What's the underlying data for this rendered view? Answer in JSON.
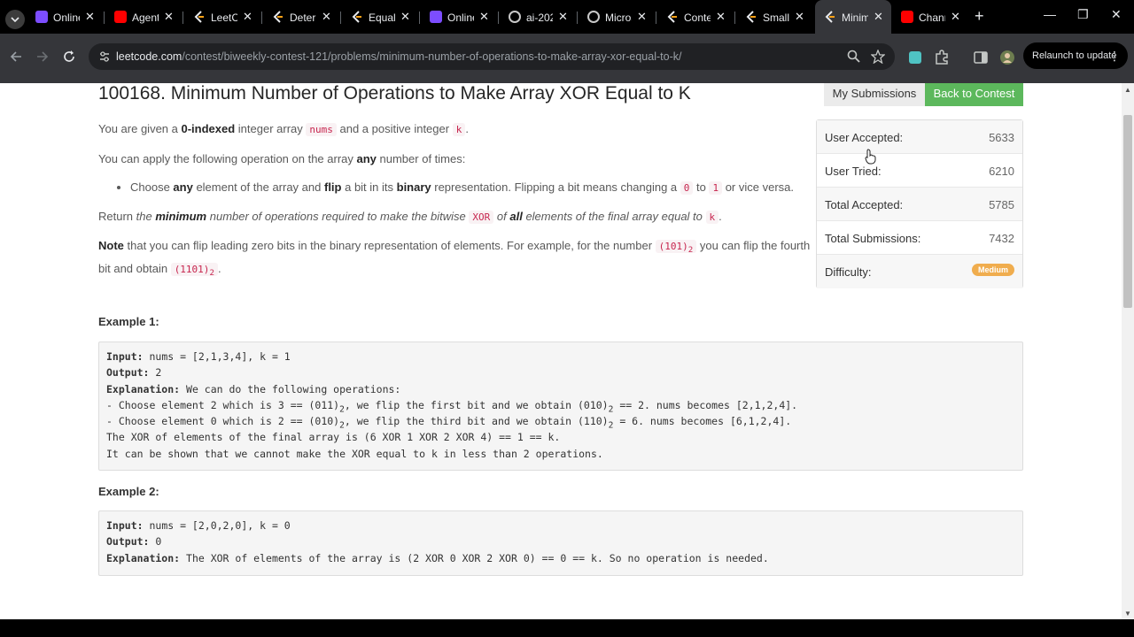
{
  "tabs": [
    {
      "title": "Online",
      "icon": "lightning-icon",
      "color": "#7c4dff"
    },
    {
      "title": "Agents",
      "icon": "youtube-icon",
      "color": "#ff0000"
    },
    {
      "title": "LeetCo",
      "icon": "leetcode-icon",
      "color": "#ffa116"
    },
    {
      "title": "Determ",
      "icon": "leetcode-icon",
      "color": "#ffa116"
    },
    {
      "title": "Equal I",
      "icon": "leetcode-icon",
      "color": "#ffa116"
    },
    {
      "title": "Online",
      "icon": "lightning-icon",
      "color": "#7c4dff"
    },
    {
      "title": "ai-202",
      "icon": "globe-icon",
      "color": "#c8c8c8"
    },
    {
      "title": "Micros",
      "icon": "globe-icon",
      "color": "#c8c8c8"
    },
    {
      "title": "Conte",
      "icon": "leetcode-icon",
      "color": "#ffa116"
    },
    {
      "title": "Smalle",
      "icon": "leetcode-icon",
      "color": "#ffa116"
    },
    {
      "title": "Minim",
      "icon": "leetcode-icon",
      "color": "#ffa116",
      "active": true
    },
    {
      "title": "Chann",
      "icon": "youtube-icon",
      "color": "#ff0000"
    }
  ],
  "url": {
    "host": "leetcode.com",
    "path": "/contest/biweekly-contest-121/problems/minimum-number-of-operations-to-make-array-xor-equal-to-k/"
  },
  "toolbar": {
    "relaunch_label": "Relaunch to update"
  },
  "problem": {
    "title": "100168. Minimum Number of Operations to Make Array XOR Equal to K",
    "my_submissions": "My Submissions",
    "back_to_contest": "Back to Contest"
  },
  "description": {
    "p1_a": "You are given a ",
    "p1_b": "0-indexed",
    "p1_c": " integer array ",
    "p1_code1": "nums",
    "p1_d": " and a positive integer ",
    "p1_code2": "k",
    "p1_e": ".",
    "p2_a": "You can apply the following operation on the array ",
    "p2_b": "any",
    "p2_c": " number of times:",
    "li_a": "Choose ",
    "li_b": "any",
    "li_c": " element of the array and ",
    "li_d": "flip",
    "li_e": " a bit in its ",
    "li_f": "binary",
    "li_g": " representation. Flipping a bit means changing a ",
    "li_code1": "0",
    "li_h": " to ",
    "li_code2": "1",
    "li_i": " or vice versa.",
    "p3_a": "Return ",
    "p3_b": "the ",
    "p3_c": "minimum",
    "p3_d": " number of operations required to make the bitwise ",
    "p3_code1": "XOR",
    "p3_e": " of ",
    "p3_f": "all",
    "p3_g": " elements of the final array equal to ",
    "p3_code2": "k",
    "p3_h": ".",
    "p4_a": "Note",
    "p4_b": " that you can flip leading zero bits in the binary representation of elements. For example, for the number ",
    "p4_code1": "(101)",
    "p4_sub": "2",
    "p4_c": " you can flip the fourth bit and obtain ",
    "p4_code2": "(1101)",
    "p4_sub2": "2",
    "p4_d": "."
  },
  "stats": [
    {
      "label": "User Accepted:",
      "value": "5633"
    },
    {
      "label": "User Tried:",
      "value": "6210"
    },
    {
      "label": "Total Accepted:",
      "value": "5785"
    },
    {
      "label": "Total Submissions:",
      "value": "7432"
    },
    {
      "label": "Difficulty:",
      "value": "Medium",
      "color": "#f0ad4e"
    }
  ],
  "examples": [
    {
      "title": "Example 1:",
      "input_label": "Input:",
      "input": " nums = [2,1,3,4], k = 1",
      "output_label": "Output:",
      "output": " 2",
      "expl_label": "Explanation:",
      "expl": " We can do the following operations:",
      "l1a": "- Choose element 2 which is 3 == (011)",
      "l1s": "2",
      "l1b": ", we flip the first bit and we obtain (010)",
      "l1s2": "2",
      "l1c": " == 2. nums becomes [2,1,2,4].",
      "l2a": "- Choose element 0 which is 2 == (010)",
      "l2s": "2",
      "l2b": ", we flip the third bit and we obtain (110)",
      "l2s2": "2",
      "l2c": " = 6. nums becomes [6,1,2,4].",
      "l3": "The XOR of elements of the final array is (6 XOR 1 XOR 2 XOR 4) == 1 == k.",
      "l4": "It can be shown that we cannot make the XOR equal to k in less than 2 operations."
    },
    {
      "title": "Example 2:",
      "input_label": "Input:",
      "input": " nums = [2,0,2,0], k = 0",
      "output_label": "Output:",
      "output": " 0",
      "expl_label": "Explanation:",
      "expl": " The XOR of elements of the array is (2 XOR 0 XOR 2 XOR 0) == 0 == k. So no operation is needed."
    }
  ]
}
